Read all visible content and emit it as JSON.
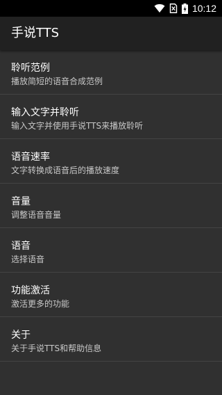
{
  "status_bar": {
    "time": "10:12",
    "icons": [
      "wifi-icon",
      "sim-icon",
      "battery-icon"
    ]
  },
  "app_bar": {
    "title": "手说TTS"
  },
  "settings": {
    "items": [
      {
        "title": "聆听范例",
        "summary": "播放简短的语音合成范例"
      },
      {
        "title": "输入文字并聆听",
        "summary": "输入文字并使用手说TTS来播放聆听"
      },
      {
        "title": "语音速率",
        "summary": "文字转换成语音后的播放速度"
      },
      {
        "title": "音量",
        "summary": "调整语音音量"
      },
      {
        "title": "语音",
        "summary": "选择语音"
      },
      {
        "title": "功能激活",
        "summary": "激活更多的功能"
      },
      {
        "title": "关于",
        "summary": "关于手说TTS和帮助信息"
      }
    ]
  },
  "colors": {
    "background": "#303030",
    "app_bar": "#212121",
    "status_bar": "#000000",
    "divider": "#444444",
    "text_primary": "#ffffff",
    "text_secondary": "#c8c8c8"
  }
}
